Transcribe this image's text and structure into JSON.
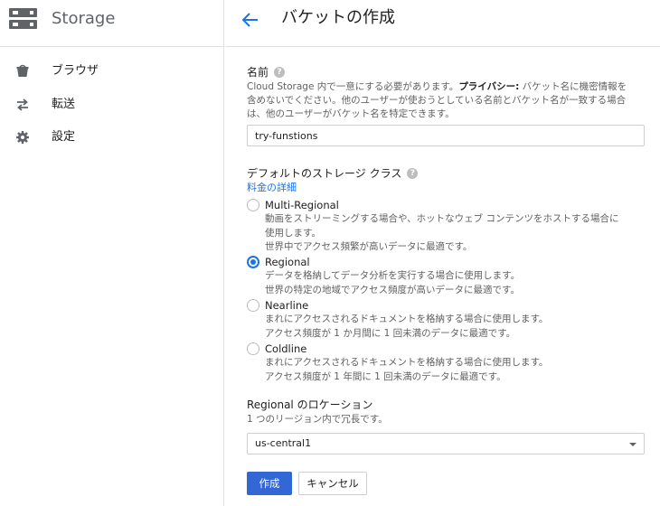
{
  "app": {
    "product_title": "Storage"
  },
  "sidebar": {
    "items": [
      {
        "label": "ブラウザ",
        "icon": "bucket-icon"
      },
      {
        "label": "転送",
        "icon": "transfer-arrows-icon"
      },
      {
        "label": "設定",
        "icon": "gear-icon"
      }
    ]
  },
  "header": {
    "title": "バケットの作成",
    "back_icon": "arrow-left-icon"
  },
  "form": {
    "name": {
      "label": "名前",
      "help_line1_pre": "Cloud Storage 内で一意にする必要があります。",
      "help_line1_bold": "プライバシー:",
      "help_line1_post": " バケット名に機密情報を",
      "help_line2": "含めないでください。他のユーザーが使おうとしている名前とバケット名が一致する場合",
      "help_line3": "は、他のユーザーがバケット名を特定できます。",
      "value": "try-funstions"
    },
    "storage_class": {
      "label": "デフォルトのストレージ クラス",
      "pricing_link": "料金の詳細",
      "selected": "Regional",
      "options": [
        {
          "title": "Multi-Regional",
          "desc1": "動画をストリーミングする場合や、ホットなウェブ コンテンツをホストする場合に",
          "desc2": "使用します。",
          "desc3": "世界中でアクセス頻繁が高いデータに最適です。"
        },
        {
          "title": "Regional",
          "desc1": "データを格納してデータ分析を実行する場合に使用します。",
          "desc2": "世界の特定の地域でアクセス頻度が高いデータに最適です。"
        },
        {
          "title": "Nearline",
          "desc1": "まれにアクセスされるドキュメントを格納する場合に使用します。",
          "desc2": "アクセス頻度が 1 か月間に 1 回未満のデータに最適です。"
        },
        {
          "title": "Coldline",
          "desc1": "まれにアクセスされるドキュメントを格納する場合に使用します。",
          "desc2": "アクセス頻度が 1 年間に 1 回未満のデータに最適です。"
        }
      ]
    },
    "location": {
      "label": "Regional のロケーション",
      "help": "1 つのリージョン内で冗長です。",
      "value": "us-central1"
    },
    "buttons": {
      "create": "作成",
      "cancel": "キャンセル"
    }
  },
  "colors": {
    "accent": "#1a73e8",
    "primary_button": "#3367d6",
    "icon_gray": "#5f6368"
  }
}
